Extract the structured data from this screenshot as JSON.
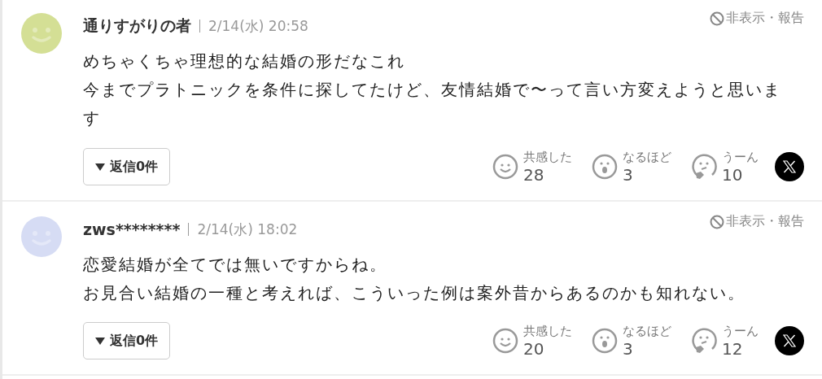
{
  "comments": [
    {
      "author": "通りすがりの者",
      "date": "2/14(水) 20:58",
      "avatar": {
        "color": "#d4df95"
      },
      "report": "非表示・報告",
      "body": [
        "めちゃくちゃ理想的な結婚の形だなこれ",
        "今までプラトニックを条件に探してたけど、友情結婚で〜って言い方変えようと思います"
      ],
      "replies": "返信0件",
      "reactions": [
        {
          "kind": "empathy",
          "label": "共感した",
          "count": "28"
        },
        {
          "kind": "insight",
          "label": "なるほど",
          "count": "3"
        },
        {
          "kind": "doubt",
          "label": "うーん",
          "count": "10"
        }
      ]
    },
    {
      "author": "zws********",
      "date": "2/14(水) 18:02",
      "avatar": {
        "color": "#d6dcf4"
      },
      "report": "非表示・報告",
      "body": [
        "恋愛結婚が全てでは無いですからね。",
        "お見合い結婚の一種と考えれば、こういった例は案外昔からあるのかも知れない。"
      ],
      "replies": "返信0件",
      "reactions": [
        {
          "kind": "empathy",
          "label": "共感した",
          "count": "20"
        },
        {
          "kind": "insight",
          "label": "なるほど",
          "count": "3"
        },
        {
          "kind": "doubt",
          "label": "うーん",
          "count": "12"
        }
      ]
    }
  ]
}
